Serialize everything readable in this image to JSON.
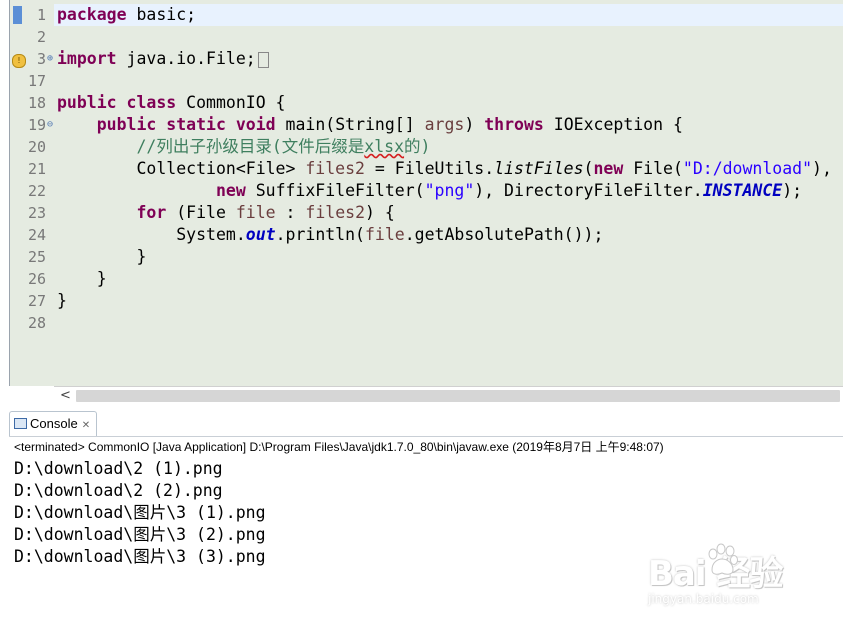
{
  "editor": {
    "line_numbers": [
      "1",
      "2",
      "3",
      "17",
      "18",
      "19",
      "20",
      "21",
      "22",
      "23",
      "24",
      "25",
      "26",
      "27",
      "28"
    ],
    "lines": {
      "l1": {
        "kw": "package",
        "rest": " basic;"
      },
      "l3": {
        "kw": "import",
        "rest": " java.io.File;"
      },
      "l18": {
        "kw1": "public",
        "kw2": "class",
        "rest": " CommonIO {"
      },
      "l19": {
        "kw1": "public",
        "kw2": "static",
        "kw3": "void",
        "mid": " main(String[] ",
        "param": "args",
        "kw4": "throws",
        "rest": " IOException {"
      },
      "l20": {
        "comment_a": "//列出子孙级目录(文件后缀是",
        "comment_sq": "xlsx",
        "comment_b": "的)"
      },
      "l21": {
        "a": "Collection<File> ",
        "var": "files2",
        "b": " = FileUtils.",
        "method": "listFiles",
        "c": "(",
        "kw": "new",
        "d": " File(",
        "str": "\"D:/download\"",
        "e": "),"
      },
      "l22": {
        "kw": "new",
        "a": " SuffixFileFilter(",
        "str": "\"png\"",
        "b": "), DirectoryFileFilter.",
        "field": "INSTANCE",
        "c": ");"
      },
      "l23": {
        "kw": "for",
        "a": " (File ",
        "var": "file",
        "b": " : ",
        "var2": "files2",
        "c": ") {"
      },
      "l24": {
        "a": "System.",
        "field": "out",
        "b": ".println(",
        "var": "file",
        "c": ".getAbsolutePath());"
      },
      "l25": {
        "a": "}"
      },
      "l26": {
        "a": "}"
      },
      "l27": {
        "a": "}"
      }
    },
    "scroll_left_arrow": "<"
  },
  "console": {
    "tab_label": "Console",
    "tab_close": "✕",
    "status": "<terminated> CommonIO [Java Application] D:\\Program Files\\Java\\jdk1.7.0_80\\bin\\javaw.exe (2019年8月7日 上午9:48:07)",
    "output": [
      "D:\\download\\2 (1).png",
      "D:\\download\\2 (2).png",
      "D:\\download\\图片\\3 (1).png",
      "D:\\download\\图片\\3 (2).png",
      "D:\\download\\图片\\3 (3).png"
    ]
  },
  "watermark": {
    "text": "Bai  经验",
    "sub": "jingyan.baidu.com"
  },
  "colors": {
    "editor_bg": "#e5ebe1",
    "keyword": "#7f0055",
    "string": "#2a00ff",
    "comment": "#3f7f5f",
    "field": "#0000c0",
    "local_var": "#6a3e3e"
  }
}
